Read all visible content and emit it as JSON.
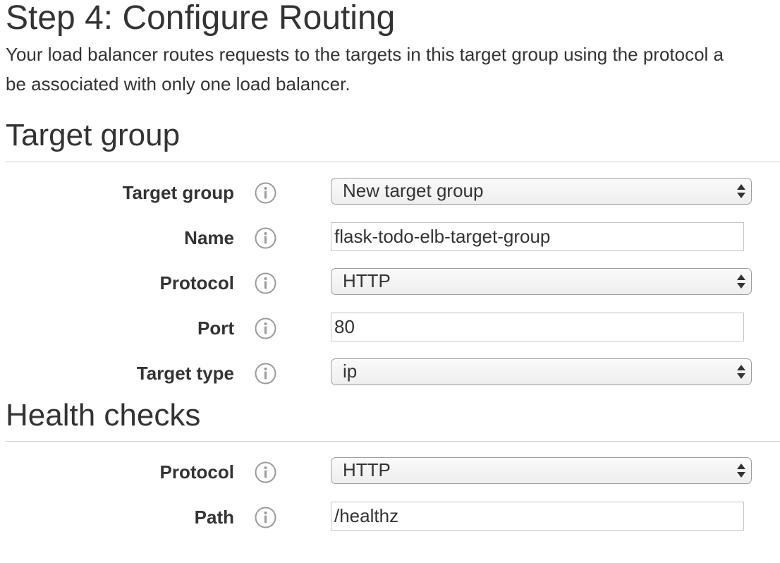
{
  "page": {
    "title": "Step 4: Configure Routing",
    "intro_line1": "Your load balancer routes requests to the targets in this target group using the protocol a",
    "intro_line2": "be associated with only one load balancer."
  },
  "target_group_section": {
    "heading": "Target group",
    "fields": {
      "target_group": {
        "label": "Target group",
        "value": "New target group"
      },
      "name": {
        "label": "Name",
        "value": "flask-todo-elb-target-group"
      },
      "protocol": {
        "label": "Protocol",
        "value": "HTTP"
      },
      "port": {
        "label": "Port",
        "value": "80"
      },
      "target_type": {
        "label": "Target type",
        "value": "ip"
      }
    }
  },
  "health_checks_section": {
    "heading": "Health checks",
    "fields": {
      "protocol": {
        "label": "Protocol",
        "value": "HTTP"
      },
      "path": {
        "label": "Path",
        "value": "/healthz"
      }
    }
  },
  "icons": {
    "info": "info-icon",
    "select_arrows": "up-down-arrows-icon"
  },
  "colors": {
    "text": "#333333",
    "rule": "#cccccc",
    "icon": "#9a9a9a",
    "select_border": "#9e9e9e",
    "input_border": "#c4c4c4"
  }
}
